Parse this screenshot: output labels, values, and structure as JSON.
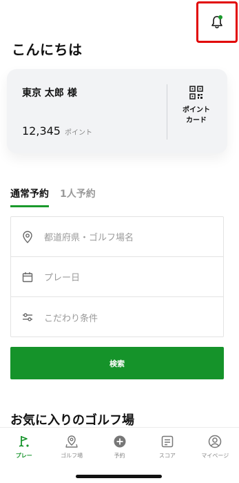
{
  "header": {
    "greeting": "こんにちは",
    "notification_icon": "bell-icon",
    "notification_dot_color": "#1a9a2c",
    "highlight_color": "#e10000"
  },
  "card": {
    "name": "東京 太郎 様",
    "points_value": "12,345",
    "points_unit": "ポイント",
    "point_card_label": "ポイント\nカード",
    "point_card_icon": "qr-code-icon"
  },
  "tabs": [
    {
      "label": "通常予約",
      "active": true
    },
    {
      "label": "1人予約",
      "active": false
    }
  ],
  "form": {
    "location_placeholder": "都道府県・ゴルフ場名",
    "date_placeholder": "プレー日",
    "conditions_placeholder": "こだわり条件"
  },
  "search_button": {
    "label": "検索",
    "color": "#15932a"
  },
  "favorites": {
    "title": "お気に入りのゴルフ場"
  },
  "bottom_nav": [
    {
      "label": "プレー",
      "icon": "golf-flag-icon",
      "active": true
    },
    {
      "label": "ゴルフ場",
      "icon": "map-pin-icon",
      "active": false
    },
    {
      "label": "予約",
      "icon": "plus-circle-icon",
      "active": false
    },
    {
      "label": "スコア",
      "icon": "scorecard-icon",
      "active": false
    },
    {
      "label": "マイページ",
      "icon": "user-icon",
      "active": false
    }
  ]
}
